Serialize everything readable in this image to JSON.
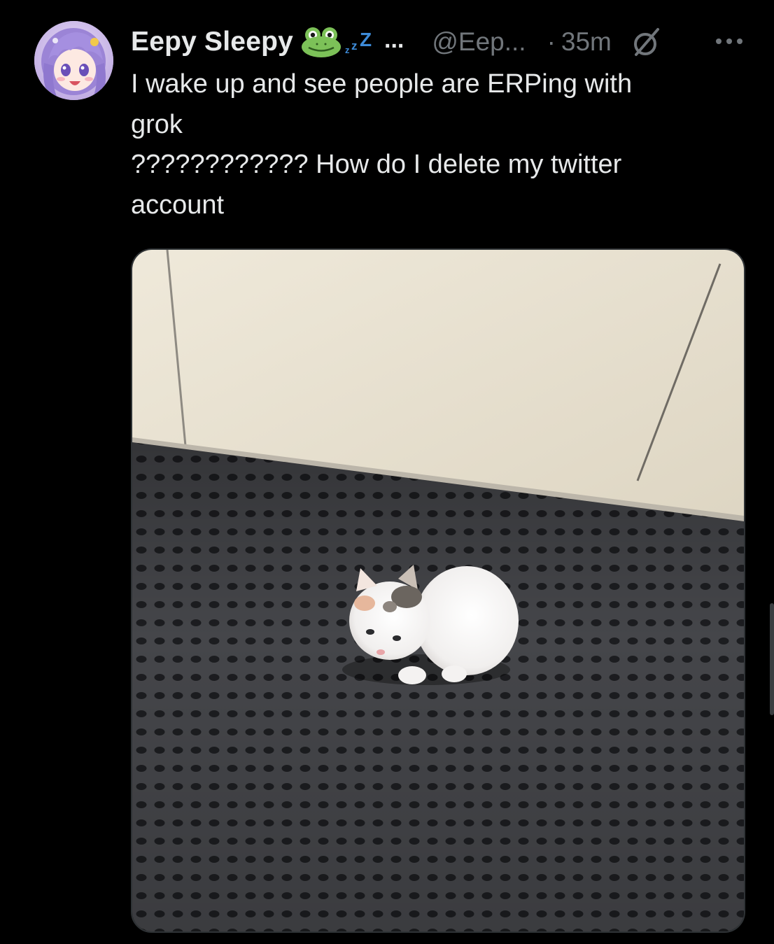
{
  "tweet": {
    "author": {
      "display_name": "Eepy Sleepy",
      "name_emojis": [
        "frog-emoji",
        "zzz-emoji"
      ],
      "name_truncation": "...",
      "handle": "@Eep...",
      "avatar": "anime-girl-purple-hair-avatar"
    },
    "separator": "·",
    "timestamp": "35m",
    "badge_icon": "grok-icon",
    "more_icon": "more-horizontal-icon",
    "text": "I wake up and see people are ERPing with\ngrok\n???????????? How do I delete my twitter\naccount",
    "media": {
      "type": "video-thumbnail",
      "subject": "white kitten on black mat"
    }
  },
  "colors": {
    "background": "#000000",
    "primary_text": "#e7e9ea",
    "secondary_text": "#71767b",
    "border": "#2f3336"
  }
}
